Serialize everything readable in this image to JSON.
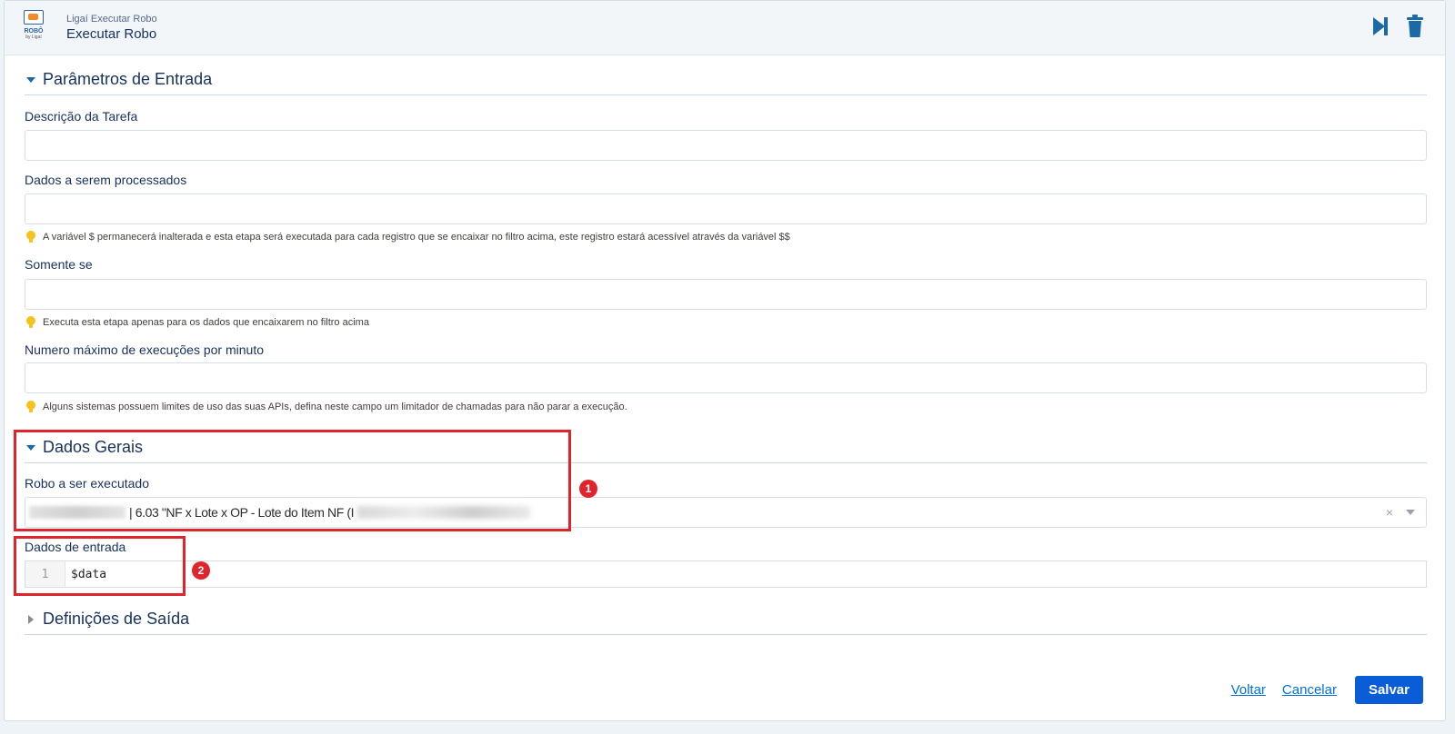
{
  "header": {
    "logo_text": "ROBÔ",
    "logo_sub": "by Ligaí",
    "subtitle": "Ligaí Executar Robo",
    "title": "Executar Robo"
  },
  "sections": {
    "input_params": "Parâmetros de Entrada",
    "general": "Dados Gerais",
    "output": "Definições de Saída"
  },
  "fields": {
    "task_description": {
      "label": "Descrição da Tarefa",
      "value": ""
    },
    "data_to_process": {
      "label": "Dados a serem processados",
      "value": "",
      "hint": "A variável $ permanecerá inalterada e esta etapa será executada para cada registro que se encaixar no filtro acima, este registro estará acessível através da variável $$"
    },
    "only_if": {
      "label": "Somente se",
      "value": "",
      "hint": "Executa esta etapa apenas para os dados que encaixarem no filtro acima"
    },
    "max_exec": {
      "label": "Numero máximo de execuções por minuto",
      "value": "",
      "hint": "Alguns sistemas possuem limites de uso das suas APIs, defina neste campo um limitador de chamadas para não parar a execução."
    },
    "robot": {
      "label": "Robo a ser executado",
      "selected": "| 6.03 \"NF x Lote x OP - Lote do Item NF (I",
      "clear": "×"
    },
    "input_data": {
      "label": "Dados de entrada",
      "line_number": "1",
      "code": "$data"
    }
  },
  "annotations": {
    "badge1": "1",
    "badge2": "2"
  },
  "footer": {
    "back": "Voltar",
    "cancel": "Cancelar",
    "save": "Salvar"
  },
  "colors": {
    "accent": "#0070d2",
    "primary": "#0b5cd7",
    "highlight": "#e0242b",
    "icon": "#1b6aa5"
  }
}
